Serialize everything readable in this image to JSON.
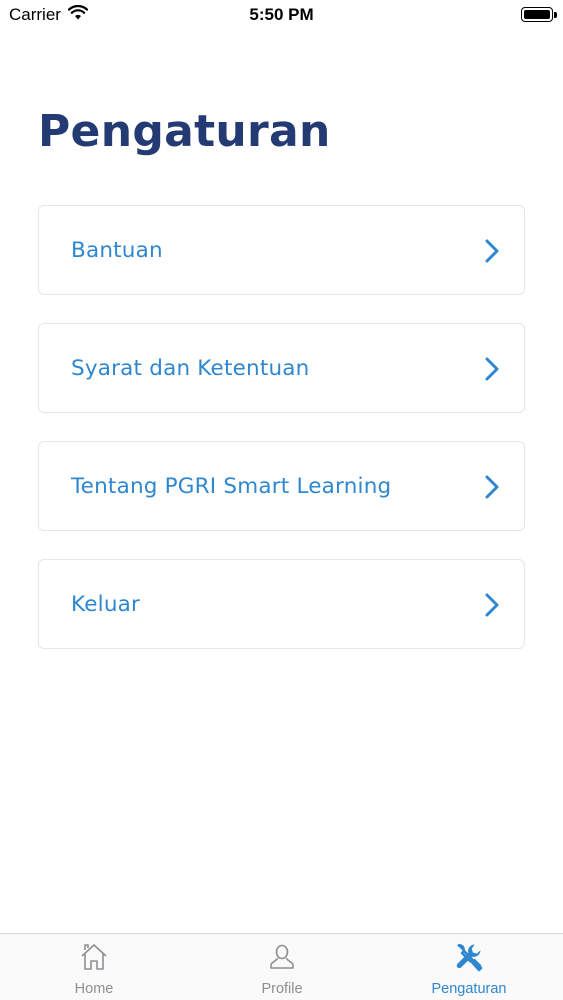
{
  "status_bar": {
    "carrier": "Carrier",
    "time": "5:50 PM",
    "icons": [
      "wifi-icon",
      "battery-icon"
    ]
  },
  "page": {
    "title": "Pengaturan"
  },
  "menu": {
    "items": [
      {
        "label": "Bantuan",
        "icon": "chevron-right-icon"
      },
      {
        "label": "Syarat dan Ketentuan",
        "icon": "chevron-right-icon"
      },
      {
        "label": "Tentang PGRI Smart Learning",
        "icon": "chevron-right-icon"
      },
      {
        "label": "Keluar",
        "icon": "chevron-right-icon"
      }
    ]
  },
  "tab_bar": {
    "tabs": [
      {
        "label": "Home",
        "icon": "home-icon",
        "active": false
      },
      {
        "label": "Profile",
        "icon": "person-icon",
        "active": false
      },
      {
        "label": "Pengaturan",
        "icon": "tools-icon",
        "active": true
      }
    ]
  },
  "colors": {
    "title": "#243a73",
    "accent": "#2f87cf",
    "tab_inactive": "#8e8e93",
    "card_border": "#e3e6eb"
  }
}
